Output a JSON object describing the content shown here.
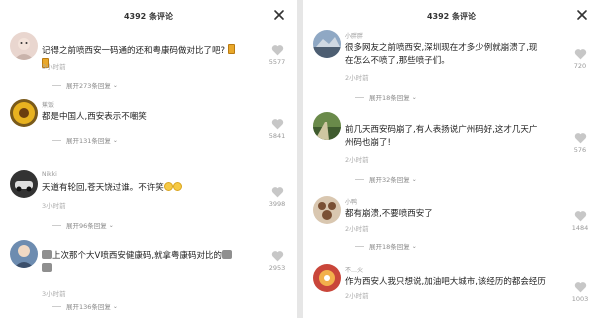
{
  "left": {
    "title": "4392 条评论",
    "comments": [
      {
        "user": "",
        "text": "记得之前喷西安一码通的还和粤康码做对比了吧?",
        "time": "3小时前",
        "expand": "展开273条回复",
        "likes": "5577"
      },
      {
        "user": "蕉饭",
        "text": "都是中国人,西安表示不嘲笑",
        "time": "",
        "expand": "展开131条回复",
        "likes": "5841"
      },
      {
        "user": "Nikki",
        "text": "天道有轮回,苍天饶过谁。不许笑",
        "time": "3小时前",
        "expand": "展开96条回复",
        "likes": "3998"
      },
      {
        "user": "",
        "text": "上次那个大V喷西安健康码,就拿粤康码对比的",
        "time": "3小时前",
        "expand": "展开136条回复",
        "likes": "2953"
      }
    ]
  },
  "right": {
    "title": "4392 条评论",
    "comments": [
      {
        "user": "小胖胖",
        "text": "很多网友之前喷西安,深圳现在才多少例就崩溃了,现在怎么不喷了,那些喷子们。",
        "time": "2小时前",
        "expand": "展开18条回复",
        "likes": "720"
      },
      {
        "user": "",
        "text": "前几天西安码崩了,有人表扬说广州码好,这才几天广州码也崩了!",
        "time": "2小时前",
        "expand": "展开32条回复",
        "likes": "576"
      },
      {
        "user": "小鸭",
        "text": "都有崩溃,不要喷西安了",
        "time": "2小时前",
        "expand": "展开18条回复",
        "likes": "1484"
      },
      {
        "user": "不…火",
        "text": "作为西安人我只想说,加油吧大城市,该经历的都会经历",
        "time": "2小时前",
        "expand": "",
        "likes": "1003"
      }
    ]
  },
  "icons": {
    "close": "close-icon",
    "like": "heart-icon"
  }
}
